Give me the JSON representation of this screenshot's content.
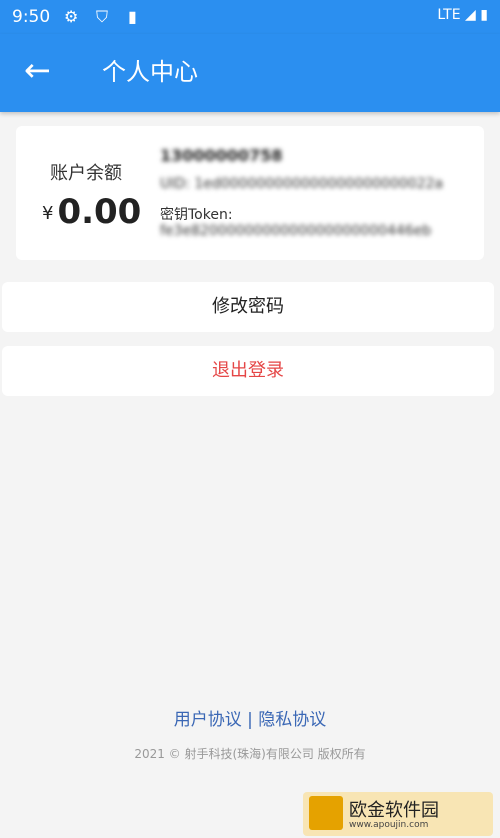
{
  "status_bar": {
    "time": "9:50",
    "network": "LTE",
    "icons": [
      "gear-icon",
      "shield-icon",
      "sd-card-icon",
      "signal-icon",
      "battery-icon"
    ]
  },
  "app_bar": {
    "title": "个人中心",
    "back_icon": "arrow-left-icon",
    "color": "#2b8ff0"
  },
  "account": {
    "balance_label": "账户余额",
    "currency": "¥",
    "balance": "0.00",
    "phone": "13000000758",
    "uid": "UID: 1ed000000000000000000000022a",
    "token_label": "密钥Token:",
    "token_value": "fe3e8200000000000000000000446eb"
  },
  "actions": {
    "change_password": "修改密码",
    "logout": "退出登录",
    "logout_color": "#e54646"
  },
  "footer": {
    "user_agreement": "用户协议",
    "separator": "|",
    "privacy_policy": "隐私协议",
    "copyright": "2021 © 射手科技(珠海)有限公司 版权所有"
  },
  "watermark": {
    "text": "欧金软件园",
    "url": "www.apoujin.com"
  }
}
